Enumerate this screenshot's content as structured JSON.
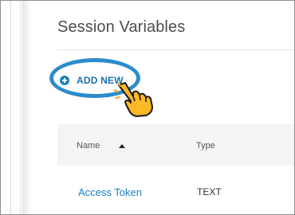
{
  "panel": {
    "title": "Session Variables",
    "add_new_label": "ADD NEW",
    "add_icon": "plus-circle-icon",
    "pointer_icon": "hand-pointer-icon",
    "highlight_color": "#2b8ccc",
    "accent_color": "#1b80c4"
  },
  "table": {
    "columns": [
      {
        "label": "Name",
        "sort": "ascending"
      },
      {
        "label": "Type"
      }
    ],
    "rows": [
      {
        "name": "Access Token",
        "type": "TEXT"
      }
    ]
  }
}
